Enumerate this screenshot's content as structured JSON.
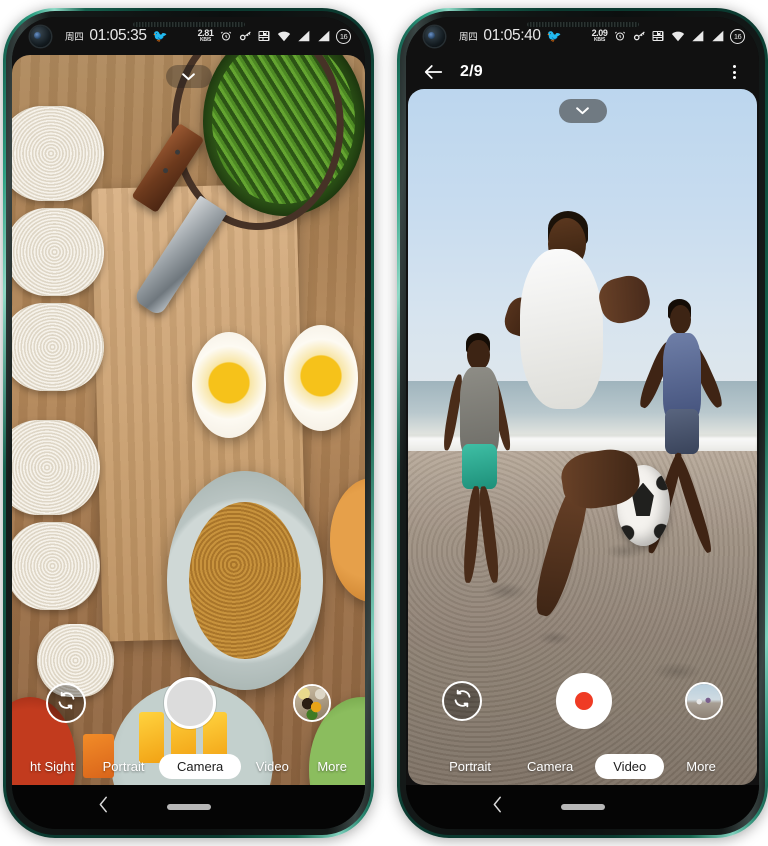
{
  "scene": {
    "description": "Two smartphones side by side showing a camera app",
    "frame_color": "#1b6a56"
  },
  "phone_left": {
    "status_bar": {
      "day": "周四",
      "time": "01:05:35",
      "bird_emoji": "🐦",
      "net_speed_value": "2.81",
      "net_speed_unit": "KB/S",
      "icons": [
        "alarm-icon",
        "key-icon",
        "qr-icon",
        "wifi-icon",
        "signal-icon",
        "signal2-icon"
      ],
      "battery_level": "16"
    },
    "viewfinder": {
      "chevron": "chevron-down-icon",
      "scene_name": "food-flatlay"
    },
    "controls": {
      "flip_label": "switch-camera",
      "shutter_label": "shutter",
      "thumbnail_label": "last-photo"
    },
    "modes": [
      {
        "label": "ht Sight",
        "active": false
      },
      {
        "label": "Portrait",
        "active": false
      },
      {
        "label": "Camera",
        "active": true
      },
      {
        "label": "Video",
        "active": false
      },
      {
        "label": "More",
        "active": false
      }
    ],
    "nav": {
      "back": "back-icon",
      "home": "home-handle"
    }
  },
  "phone_right": {
    "status_bar": {
      "day": "周四",
      "time": "01:05:40",
      "bird_emoji": "🐦",
      "net_speed_value": "2.09",
      "net_speed_unit": "KB/S",
      "icons": [
        "alarm-icon",
        "key-icon",
        "qr-icon",
        "wifi-icon",
        "signal-icon",
        "signal2-icon"
      ],
      "battery_level": "16"
    },
    "app_bar": {
      "back": "back-arrow-icon",
      "title": "2/9",
      "menu": "kebab-menu-icon"
    },
    "viewfinder": {
      "chevron": "chevron-down-icon",
      "scene_name": "beach-football"
    },
    "controls": {
      "flip_label": "switch-camera",
      "record_label": "record",
      "thumbnail_label": "last-video"
    },
    "modes": [
      {
        "label": "Portrait",
        "active": false
      },
      {
        "label": "Camera",
        "active": false
      },
      {
        "label": "Video",
        "active": true
      },
      {
        "label": "More",
        "active": false
      }
    ],
    "nav": {
      "back": "back-icon",
      "home": "home-handle"
    }
  }
}
